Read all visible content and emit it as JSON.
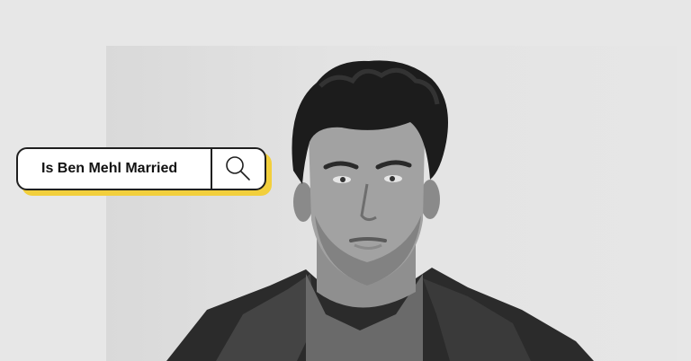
{
  "search": {
    "query": "Is Ben Mehl Married",
    "icon": "magnifier-icon"
  },
  "colors": {
    "background": "#e7e7e7",
    "panel": "#e3e3e3",
    "accent_shadow": "#f2cf3c",
    "border": "#1f1f1f"
  },
  "photo": {
    "subject": "portrait-man",
    "style": "black-and-white"
  }
}
